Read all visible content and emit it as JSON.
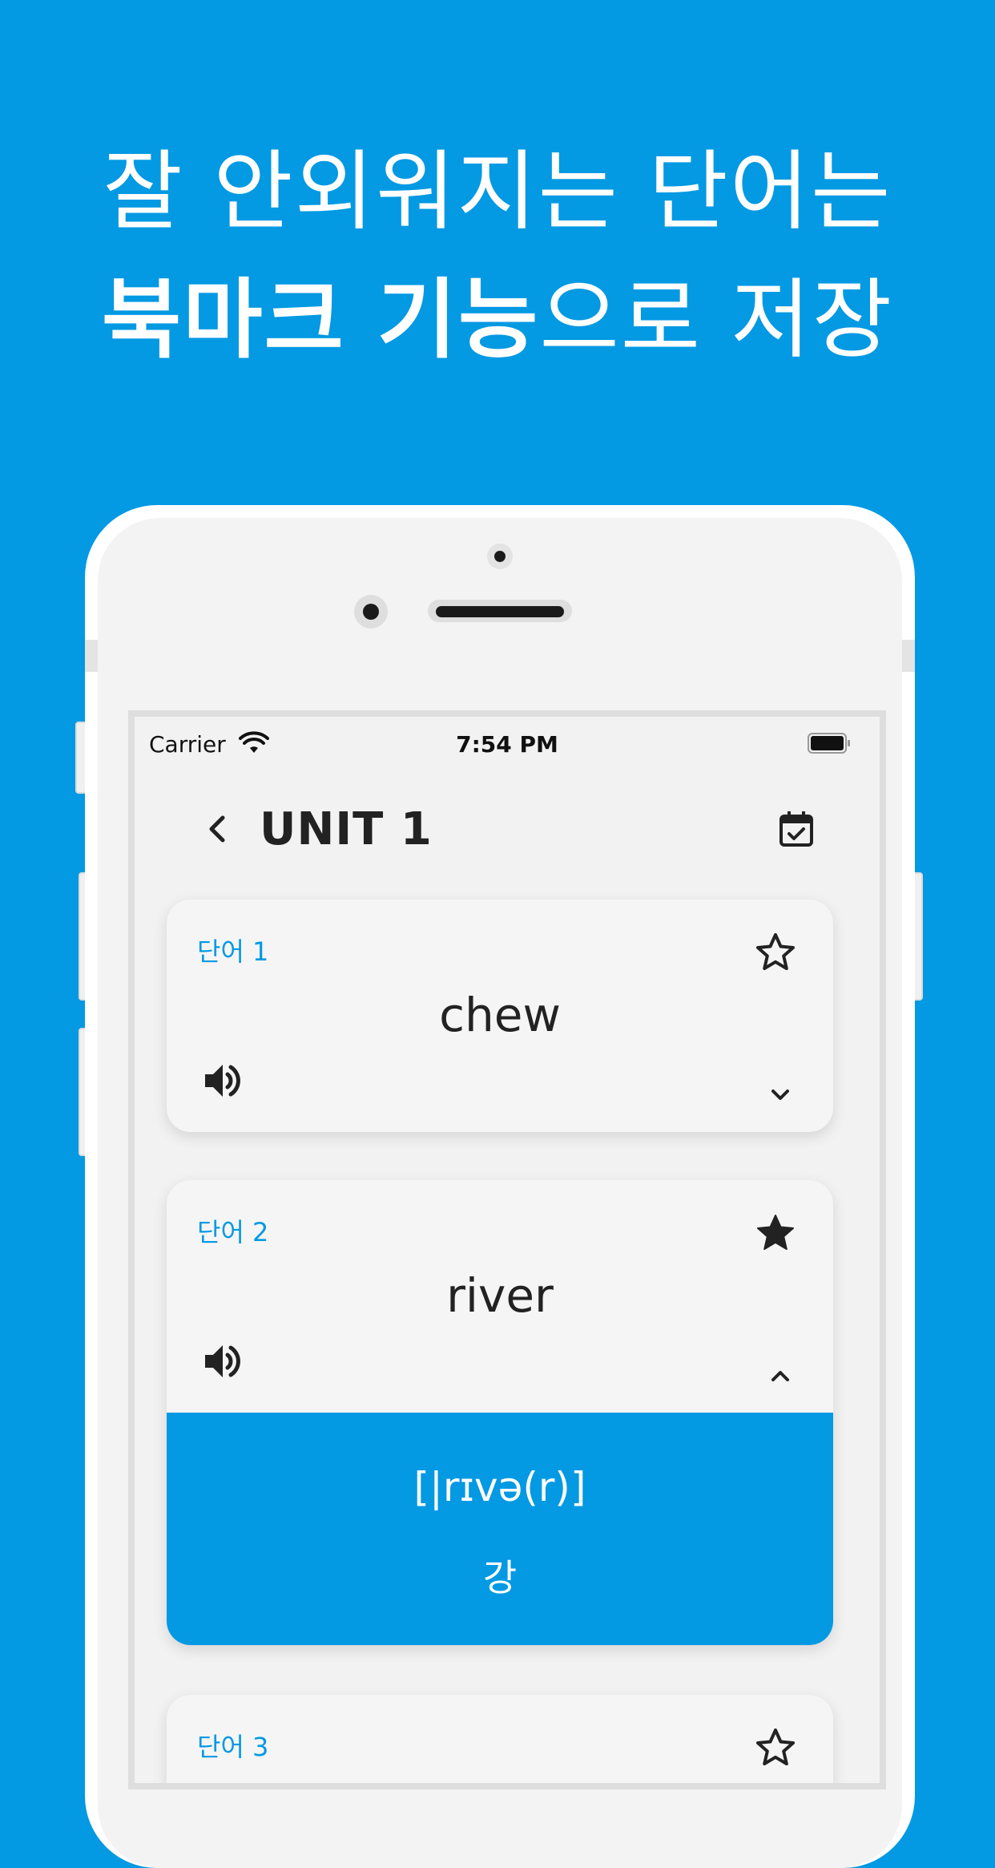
{
  "headline": {
    "line1": "잘 안외워지는 단어는",
    "line2_bold": "북마크 기능",
    "line2_rest": "으로 저장"
  },
  "status_bar": {
    "carrier": "Carrier",
    "time": "7:54 PM"
  },
  "nav": {
    "title": "UNIT 1",
    "back_icon": "chevron-left-icon",
    "calendar_icon": "calendar-check-icon"
  },
  "cards": [
    {
      "label": "단어 1",
      "word": "chew",
      "bookmarked": false,
      "expanded": false
    },
    {
      "label": "단어 2",
      "word": "river",
      "bookmarked": true,
      "expanded": true,
      "pronunciation": "[|rɪvə(r)]",
      "meaning": "강"
    },
    {
      "label": "단어 3",
      "bookmarked": false
    }
  ],
  "colors": {
    "accent": "#0399e3",
    "background": "#0399e3",
    "card": "#f5f5f5",
    "text": "#222222"
  }
}
